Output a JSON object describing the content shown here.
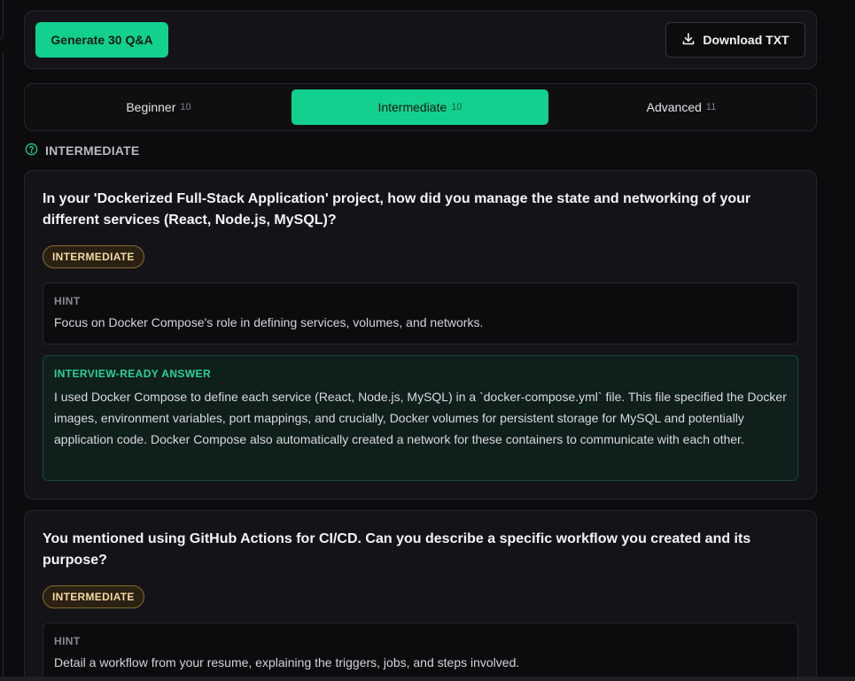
{
  "toolbar": {
    "generate_label": "Generate 30 Q&A",
    "download_label": "Download TXT",
    "accent": "#12d18e"
  },
  "tabs": [
    {
      "label": "Beginner",
      "count": "10",
      "active": false
    },
    {
      "label": "Intermediate",
      "count": "10",
      "active": true
    },
    {
      "label": "Advanced",
      "count": "11",
      "active": false
    }
  ],
  "section": {
    "heading": "INTERMEDIATE",
    "icon": "question-circle-icon"
  },
  "questions": [
    {
      "title": "In your 'Dockerized Full-Stack Application' project, how did you manage the state and networking of your different services (React, Node.js, MySQL)?",
      "level": "INTERMEDIATE",
      "hint_label": "HINT",
      "hint": "Focus on Docker Compose's role in defining services, volumes, and networks.",
      "answer_label": "INTERVIEW-READY ANSWER",
      "answer": "I used Docker Compose to define each service (React, Node.js, MySQL) in a `docker-compose.yml` file. This file specified the Docker images, environment variables, port mappings, and crucially, Docker volumes for persistent storage for MySQL and potentially application code. Docker Compose also automatically created a network for these containers to communicate with each other."
    },
    {
      "title": "You mentioned using GitHub Actions for CI/CD. Can you describe a specific workflow you created and its purpose?",
      "level": "INTERMEDIATE",
      "hint_label": "HINT",
      "hint": "Detail a workflow from your resume, explaining the triggers, jobs, and steps involved."
    }
  ],
  "colors": {
    "badge_border": "#8a6a2a",
    "answer_label": "#27d39a"
  }
}
